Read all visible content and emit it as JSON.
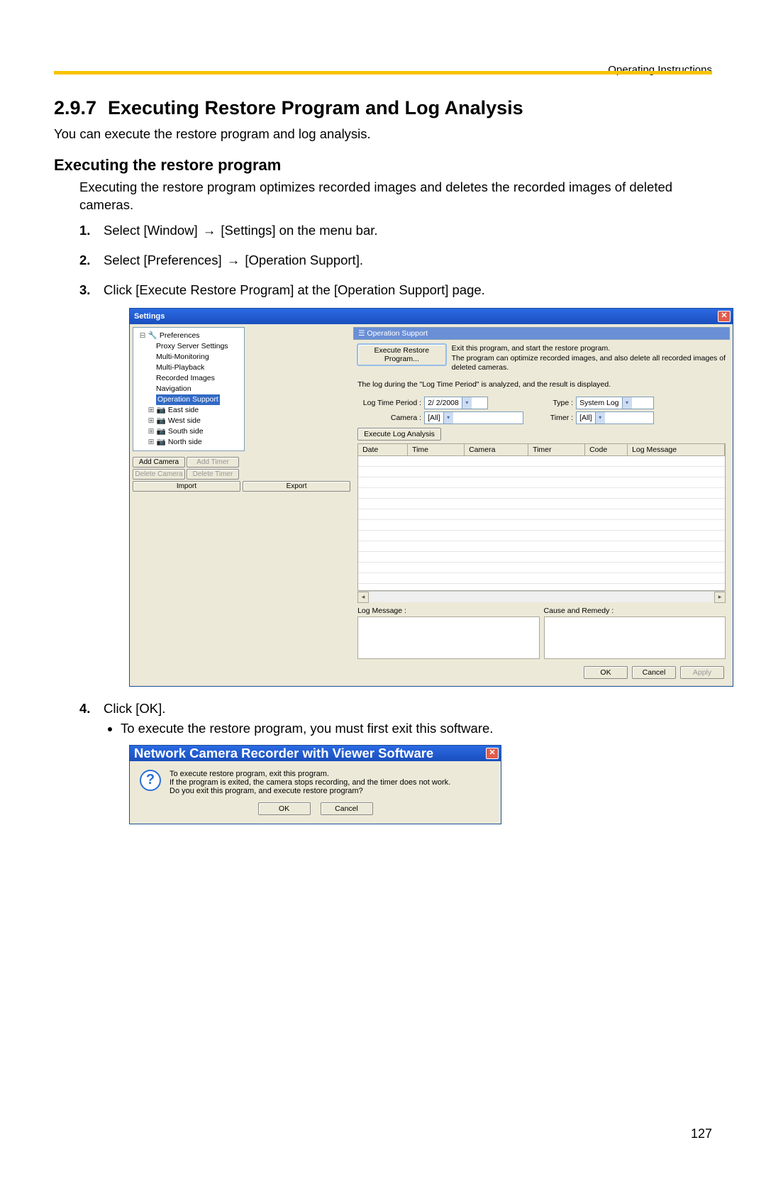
{
  "header": {
    "right": "Operating Instructions"
  },
  "section": {
    "number": "2.9.7",
    "title": "Executing Restore Program and Log Analysis",
    "intro": "You can execute the restore program and log analysis."
  },
  "subsection": {
    "title": "Executing the restore program",
    "body": "Executing the restore program optimizes recorded images and deletes the recorded images of deleted cameras."
  },
  "steps": {
    "s1_a": "Select [Window] ",
    "s1_b": " [Settings] on the menu bar.",
    "s2_a": "Select [Preferences] ",
    "s2_b": " [Operation Support].",
    "s3": "Click [Execute Restore Program] at the [Operation Support] page.",
    "s4": "Click [OK].",
    "s4_bullet": "To execute the restore program, you must first exit this software."
  },
  "settings_window": {
    "title": "Settings",
    "tree": {
      "root": "Preferences",
      "items": [
        "Proxy Server Settings",
        "Multi-Monitoring",
        "Multi-Playback",
        "Recorded Images",
        "Navigation",
        "Operation Support"
      ],
      "groups": [
        "East side",
        "West side",
        "South side",
        "North side"
      ]
    },
    "panel": {
      "header": "Operation Support",
      "exec_restore_btn": "Execute Restore Program...",
      "desc_line1": "Exit this program, and start the restore program.",
      "desc_line2": "The program can optimize recorded images, and also delete all recorded images of deleted cameras.",
      "log_note": "The log during the \"Log Time Period\" is analyzed, and the result is displayed.",
      "log_time_label": "Log Time Period :",
      "log_time_value": "2/ 2/2008",
      "type_label": "Type :",
      "type_value": "System Log",
      "camera_label": "Camera :",
      "camera_value": "[All]",
      "timer_label": "Timer :",
      "timer_value": "[All]",
      "exec_log_btn": "Execute Log Analysis",
      "columns": [
        "Date",
        "Time",
        "Camera",
        "Timer",
        "Code",
        "Log Message"
      ],
      "log_message_label": "Log Message :",
      "cause_label": "Cause and Remedy :"
    },
    "sidebar_buttons": {
      "add_camera": "Add Camera",
      "add_timer": "Add Timer",
      "delete_camera": "Delete Camera",
      "delete_timer": "Delete Timer",
      "import": "Import",
      "export": "Export"
    },
    "bottom_buttons": {
      "ok": "OK",
      "cancel": "Cancel",
      "apply": "Apply"
    }
  },
  "dialog": {
    "title": "Network Camera Recorder with Viewer Software",
    "line1": "To execute restore program, exit this program.",
    "line2": "If the program is exited, the camera stops recording, and the timer does not work.",
    "line3": "Do you exit this program, and execute restore program?",
    "ok": "OK",
    "cancel": "Cancel"
  },
  "page_number": "127"
}
